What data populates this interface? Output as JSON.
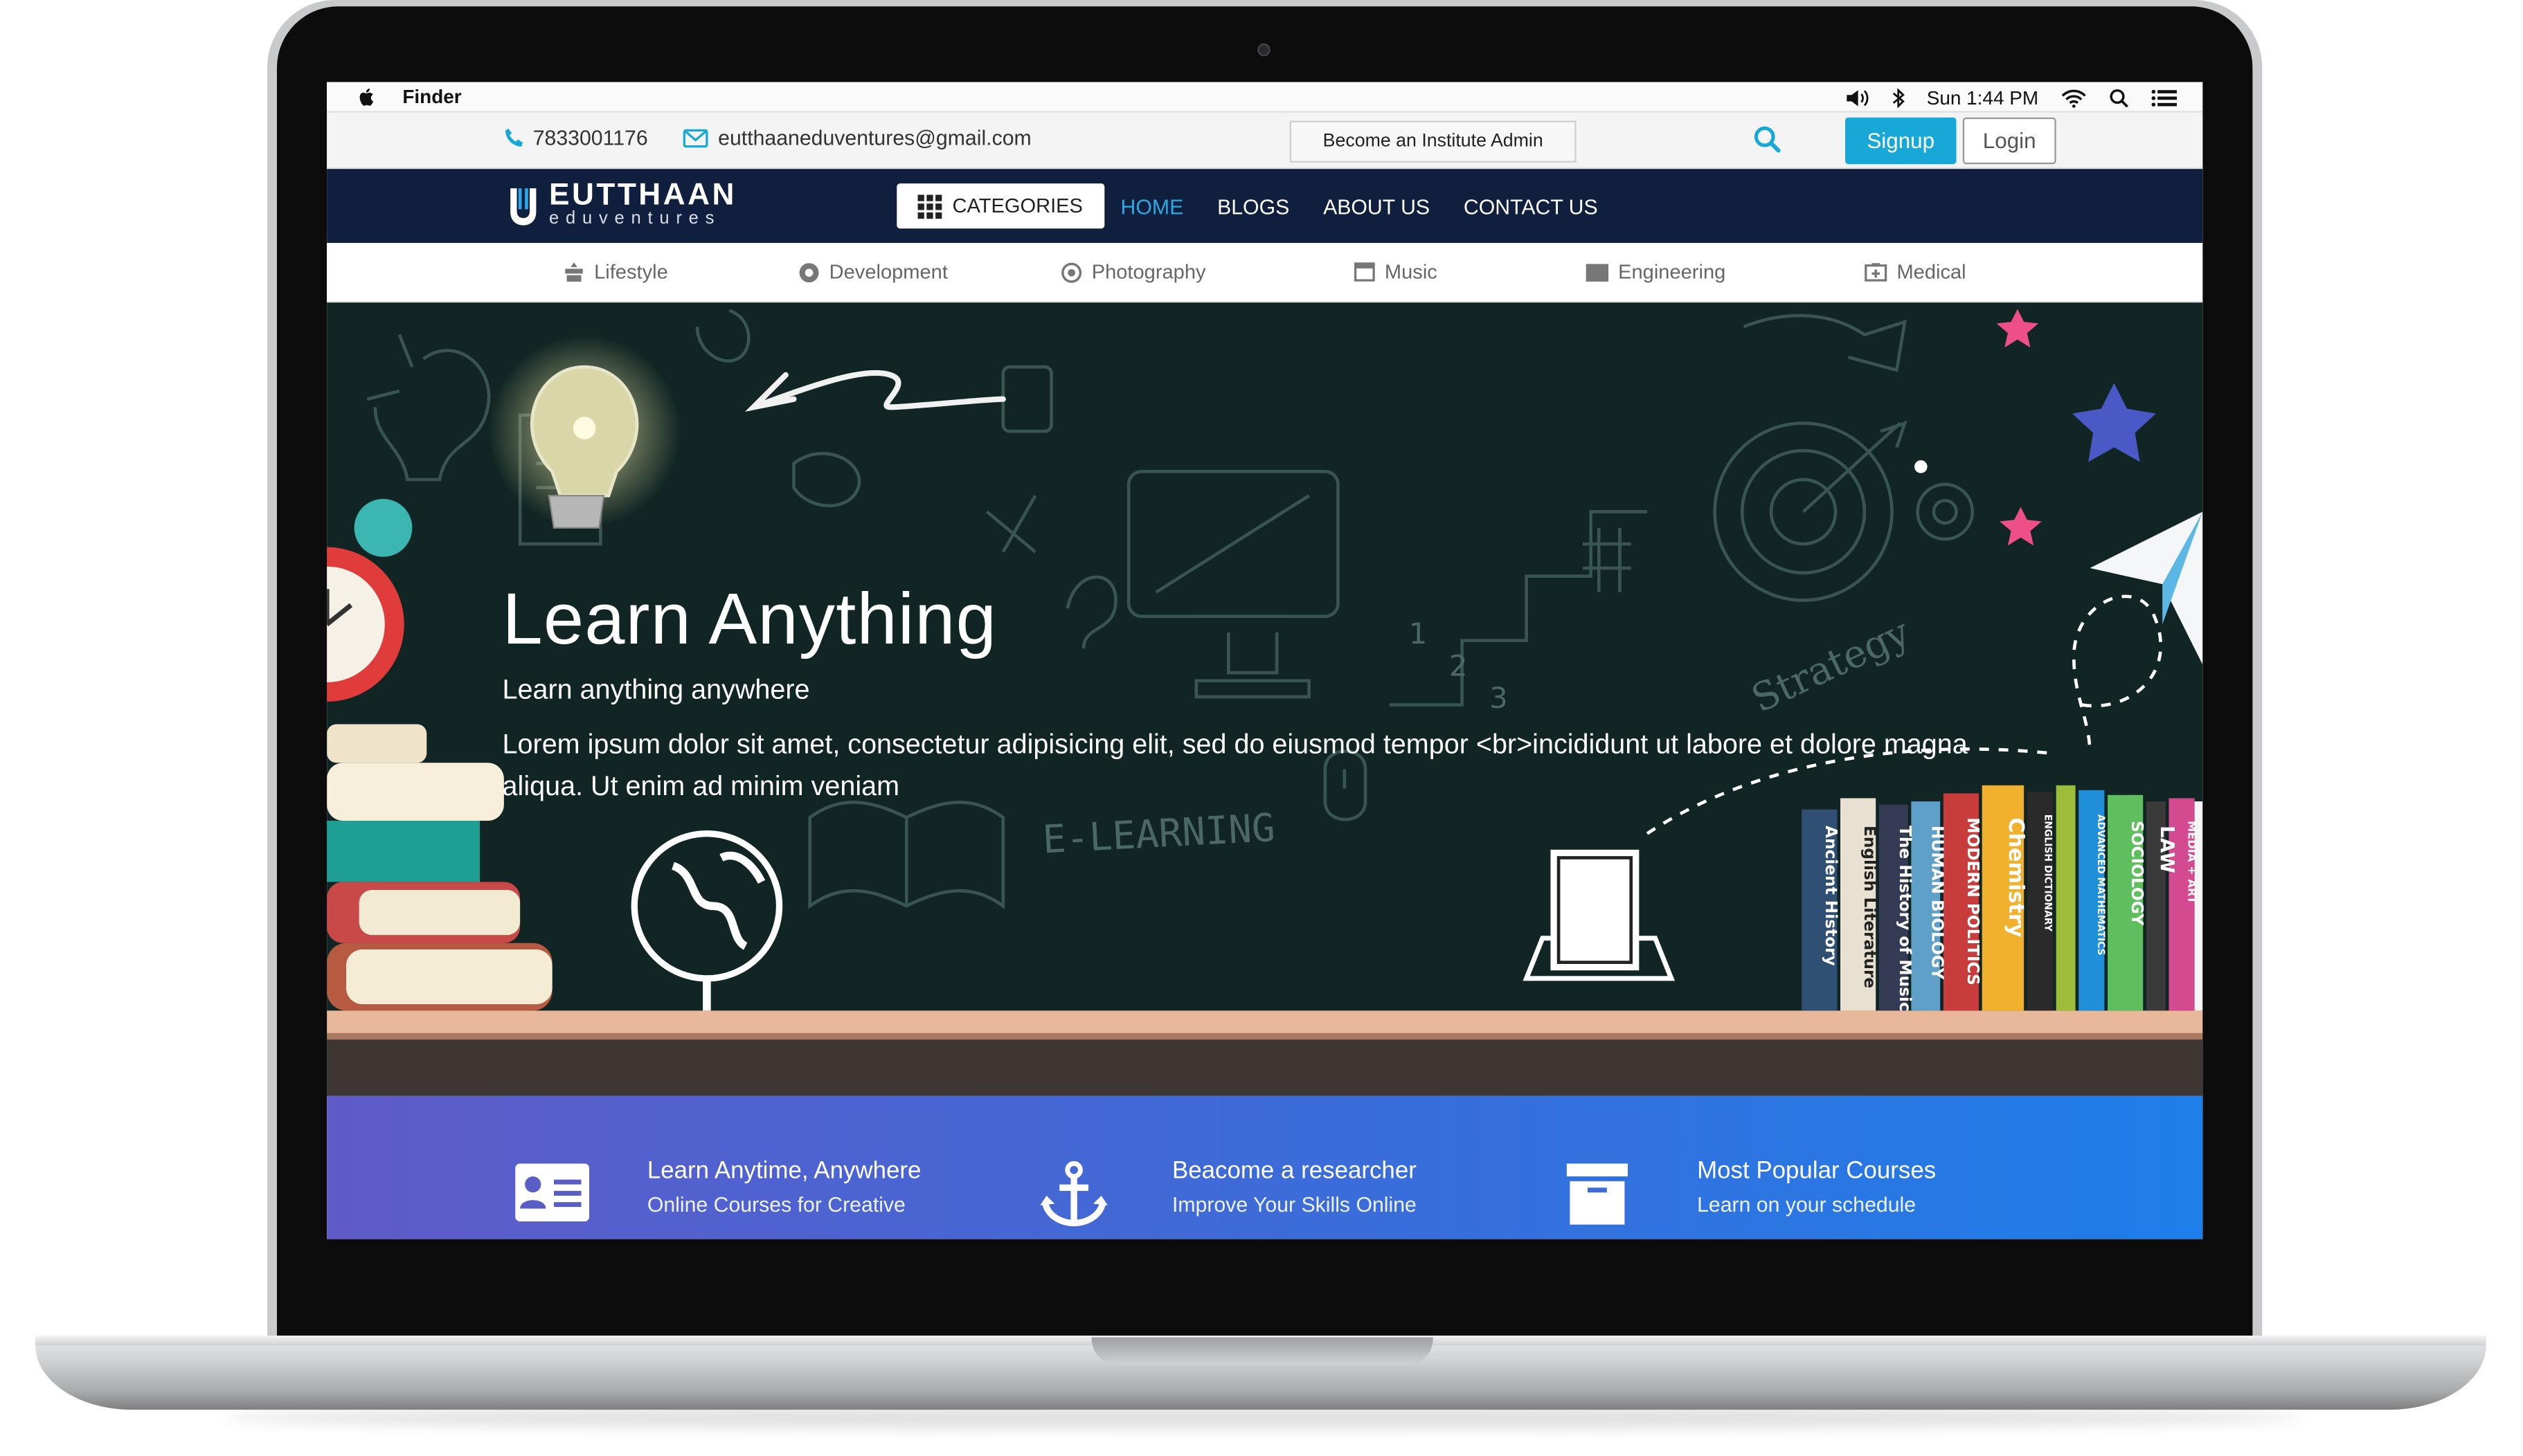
{
  "menubar": {
    "app_name": "Finder",
    "clock": "Sun 1:44 PM",
    "icons": [
      "apple-icon",
      "volume-icon",
      "bluetooth-icon",
      "wifi-icon",
      "spotlight-icon",
      "menu-list-icon"
    ]
  },
  "topbar": {
    "phone": "7833001176",
    "email": "eutthaaneduventures@gmail.com",
    "admin_button": "Become an Institute Admin",
    "signup_label": "Signup",
    "login_label": "Login",
    "accent_color": "#17a8d8"
  },
  "navbar": {
    "logo_name": "EUTTHAAN",
    "logo_sub": "eduventures",
    "categories_label": "CATEGORIES",
    "links": [
      "HOME",
      "BLOGS",
      "ABOUT US",
      "CONTACT US"
    ],
    "active": "HOME",
    "background": "#0f1f3d"
  },
  "category_strip": [
    {
      "label": "Lifestyle",
      "icon": "lifestyle-icon"
    },
    {
      "label": "Development",
      "icon": "development-icon"
    },
    {
      "label": "Photography",
      "icon": "photography-icon"
    },
    {
      "label": "Music",
      "icon": "music-icon"
    },
    {
      "label": "Engineering",
      "icon": "engineering-icon"
    },
    {
      "label": "Medical",
      "icon": "medical-icon"
    }
  ],
  "hero": {
    "title": "Learn Anything",
    "subtitle": "Learn anything anywhere",
    "body": "Lorem ipsum dolor sit amet, consectetur adipisicing elit, sed do eiusmod tempor <br>incididunt ut labore et dolore magna aliqua. Ut enim ad minim veniam",
    "chalk_words": [
      "E-LEARNING",
      "Strategy",
      "1",
      "2",
      "3"
    ],
    "book_spines": [
      "Ancient History",
      "English Literature",
      "The History of Music",
      "HUMAN BIOLOGY",
      "MODERN POLITICS",
      "Chemistry",
      "ENGLISH DICTIONARY",
      "ADVANCED MATHEMATICS",
      "SOCIOLOGY",
      "LAW",
      "MEDIA + ART"
    ]
  },
  "features": [
    {
      "title": "Learn Anytime, Anywhere",
      "subtitle": "Online Courses for Creative",
      "icon": "id-card-icon"
    },
    {
      "title": "Beacome a researcher",
      "subtitle": "Improve Your Skills Online",
      "icon": "anchor-icon"
    },
    {
      "title": "Most Popular Courses",
      "subtitle": "Learn on your schedule",
      "icon": "archive-box-icon"
    }
  ]
}
